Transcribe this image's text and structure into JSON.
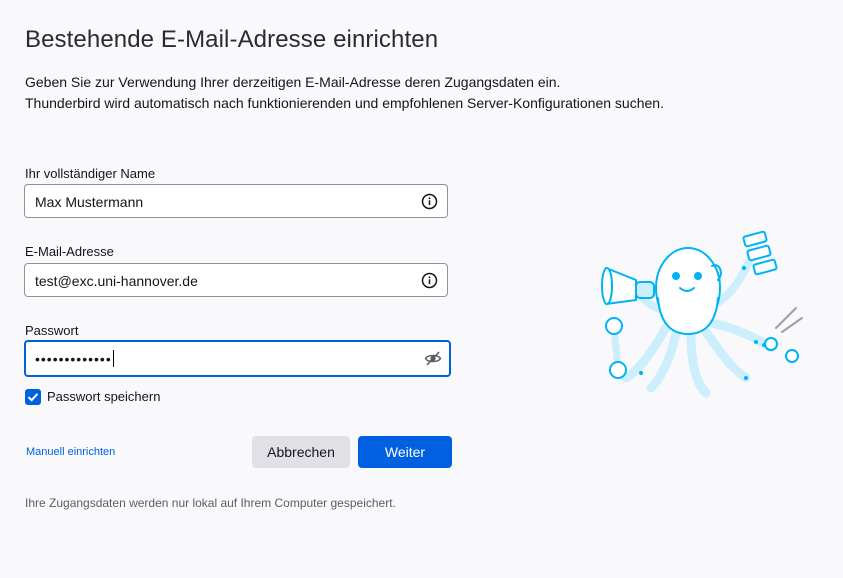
{
  "page": {
    "title": "Bestehende E-Mail-Adresse einrichten",
    "intro_line1": "Geben Sie zur Verwendung Ihrer derzeitigen E-Mail-Adresse deren Zugangsdaten ein.",
    "intro_line2": "Thunderbird wird automatisch nach funktionierenden und empfohlenen Server-Konfigurationen suchen."
  },
  "form": {
    "name_label": "Ihr vollständiger Name",
    "name_value": "Max Mustermann",
    "email_label": "E-Mail-Adresse",
    "email_value": "test@exc.uni-hannover.de",
    "password_label": "Passwort",
    "password_value": "•••••••••••••",
    "remember_password_label": "Passwort speichern",
    "remember_password_checked": true
  },
  "actions": {
    "manual_link": "Manuell einrichten",
    "cancel_label": "Abbrechen",
    "continue_label": "Weiter"
  },
  "footer": {
    "note": "Ihre Zugangsdaten werden nur lokal auf Ihrem Computer gespeichert."
  },
  "icons": {
    "info": "info-icon",
    "password_visibility": "eye-slash-icon",
    "checkbox": "check-icon",
    "illustration": "octopus-mascot"
  },
  "colors": {
    "accent": "#0061e0",
    "background": "#f9f9fb",
    "mascot": "#00b3f4"
  }
}
